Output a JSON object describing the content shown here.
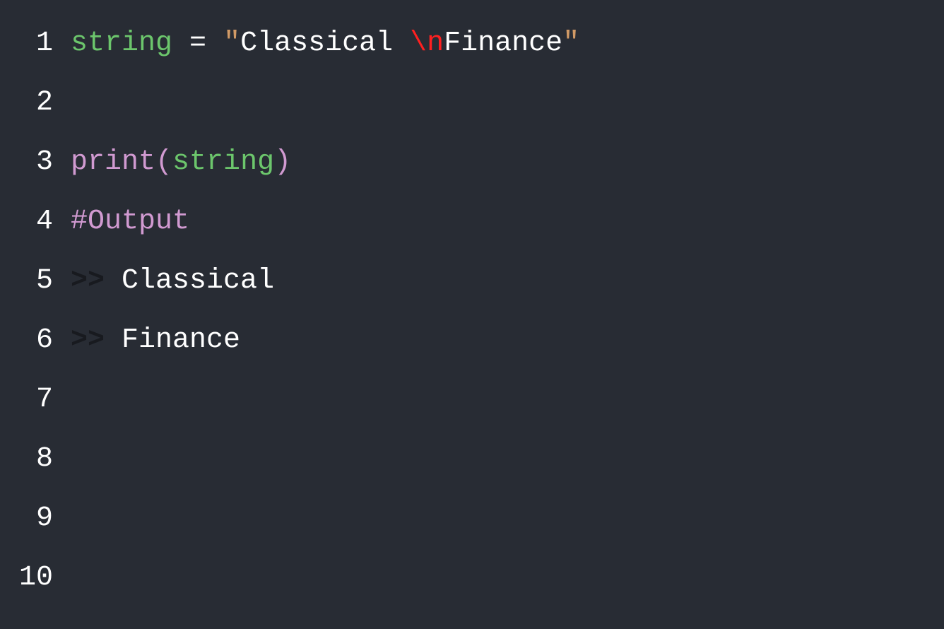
{
  "gutter": [
    "1",
    "2",
    "3",
    "4",
    "5",
    "6",
    "7",
    "8",
    "9",
    "10"
  ],
  "line1": {
    "var": "string",
    "space1": " ",
    "op": "=",
    "space2": " ",
    "quote1": "\"",
    "str1": "Classical ",
    "escape": "\\n",
    "str2": "Finance",
    "quote2": "\""
  },
  "line3": {
    "func": "print",
    "paren1": "(",
    "arg": "string",
    "paren2": ")"
  },
  "line4": {
    "comment": "#Output"
  },
  "line5": {
    "prompt": ">>",
    "space": " ",
    "out": "Classical "
  },
  "line6": {
    "prompt": ">>",
    "space": " ",
    "out": "Finance"
  }
}
